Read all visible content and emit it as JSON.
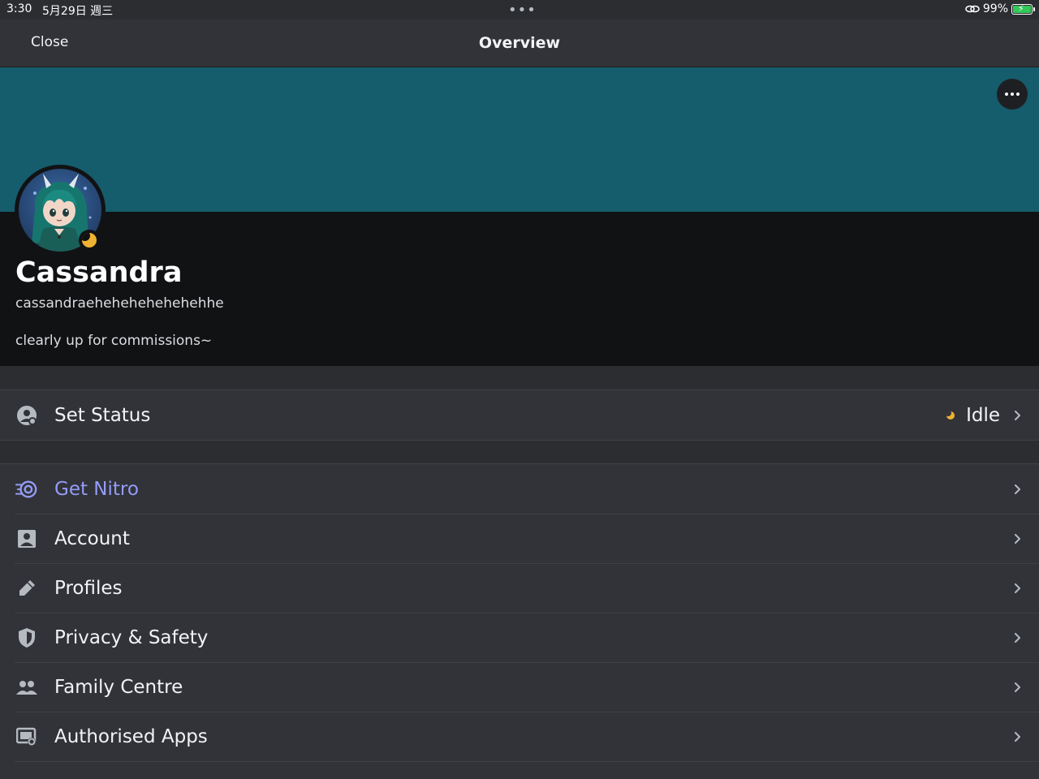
{
  "statusbar": {
    "time": "3:30",
    "date": "5月29日 週三",
    "battery": "99%",
    "battery_level": 0.99
  },
  "navbar": {
    "close_label": "Close",
    "title": "Overview"
  },
  "colors": {
    "banner": "#155c6c",
    "accent_nitro": "#949cf7",
    "idle": "#f0b232"
  },
  "profile": {
    "display_name": "Cassandra",
    "username": "cassandraehehehehehehehhe",
    "bio": "clearly up for commissions~",
    "status": "idle"
  },
  "status_row": {
    "label": "Set Status",
    "value": "Idle"
  },
  "settings": [
    {
      "label": "Get Nitro",
      "icon": "nitro-icon"
    },
    {
      "label": "Account",
      "icon": "account-icon"
    },
    {
      "label": "Profiles",
      "icon": "pencil-icon"
    },
    {
      "label": "Privacy & Safety",
      "icon": "shield-icon"
    },
    {
      "label": "Family Centre",
      "icon": "people-icon"
    },
    {
      "label": "Authorised Apps",
      "icon": "apps-icon"
    }
  ]
}
